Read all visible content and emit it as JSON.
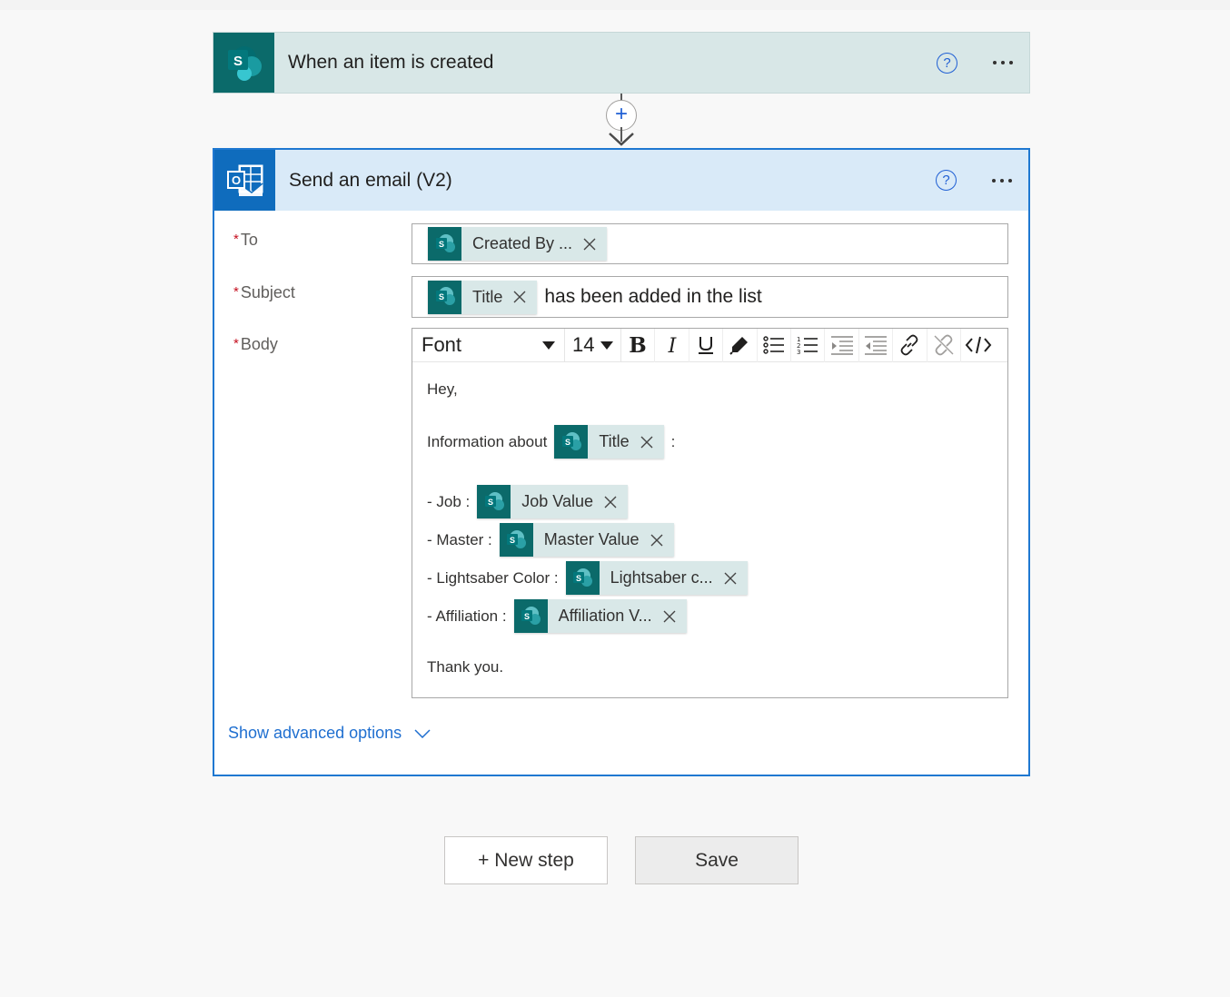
{
  "trigger": {
    "title": "When an item is created",
    "icon": "sharepoint-icon",
    "help_glyph": "?",
    "color": "#0b6a6a"
  },
  "connector": {
    "add_glyph": "+"
  },
  "action": {
    "title": "Send an email (V2)",
    "icon": "outlook-icon",
    "help_glyph": "?",
    "accent": "#1f78d1",
    "required_mark": "*",
    "fields": {
      "to": {
        "label": "To",
        "token": "Created By ..."
      },
      "subject": {
        "label": "Subject",
        "token": "Title",
        "text": "has been added in the list"
      },
      "body": {
        "label": "Body"
      }
    },
    "toolbar": {
      "font_value": "Font",
      "size_value": "14",
      "buttons": [
        "bold",
        "italic",
        "underline",
        "highlight",
        "bullet-list",
        "numbered-list",
        "decrease-indent",
        "increase-indent",
        "link",
        "unlink",
        "code-view"
      ]
    },
    "body": {
      "greeting": "Hey,",
      "info_prefix": "Information about",
      "info_token": "Title",
      "info_suffix": ":",
      "lines": [
        {
          "label": "- Job :",
          "token": "Job Value"
        },
        {
          "label": "- Master :",
          "token": "Master Value"
        },
        {
          "label": "- Lightsaber Color :",
          "token": "Lightsaber c..."
        },
        {
          "label": "- Affiliation :",
          "token": "Affiliation V..."
        }
      ],
      "closing": "Thank you."
    },
    "advanced_label": "Show advanced options"
  },
  "footer": {
    "new_step": "+ New step",
    "save": "Save"
  }
}
